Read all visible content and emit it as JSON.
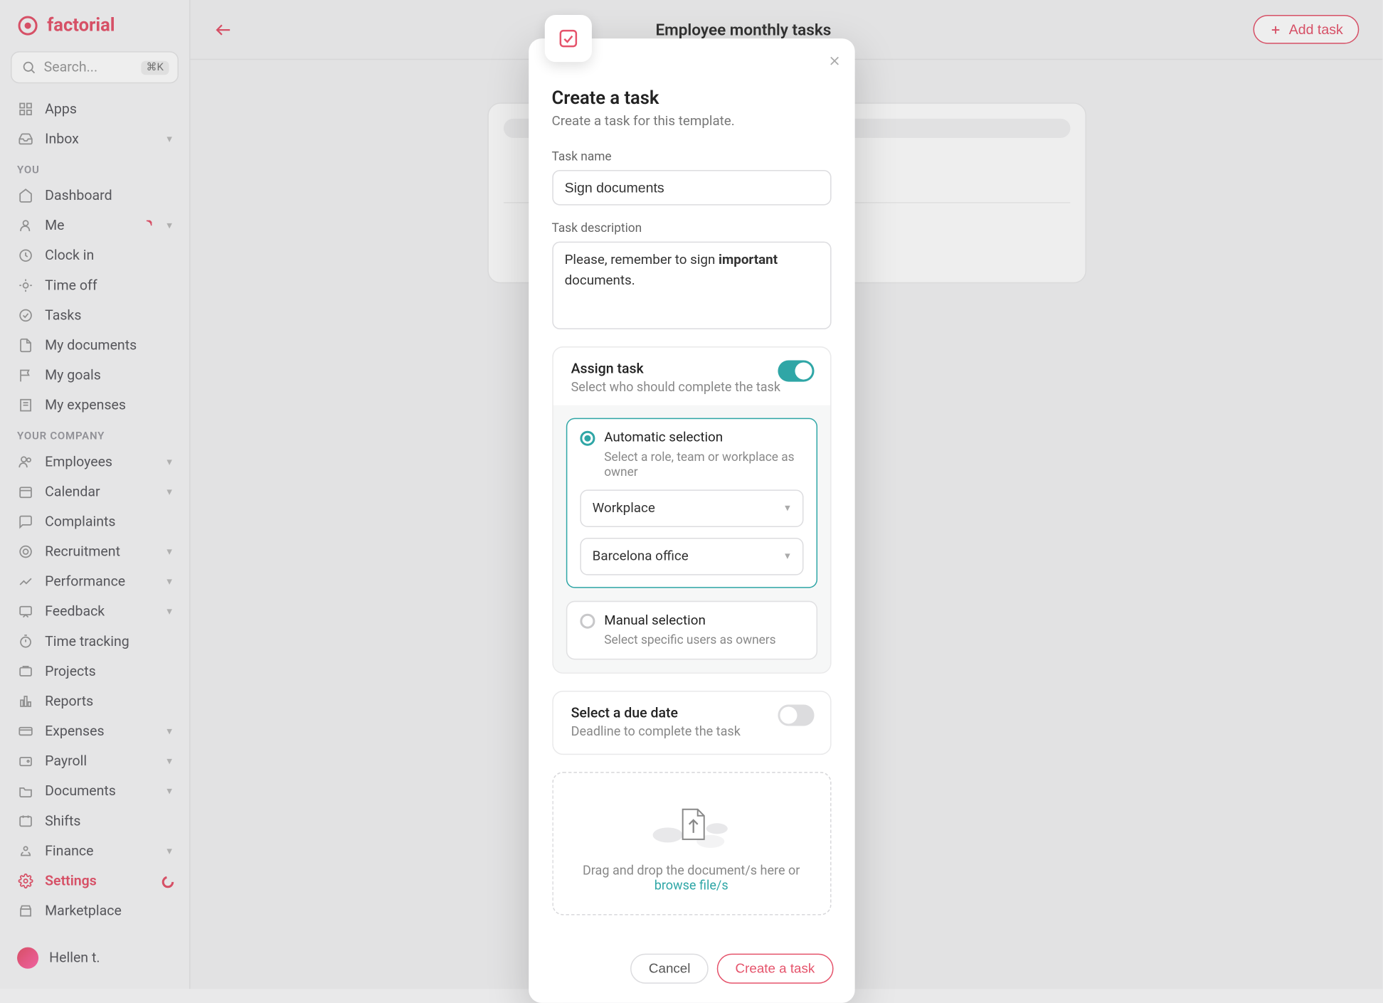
{
  "brand": {
    "name": "factorial"
  },
  "search": {
    "placeholder": "Search...",
    "shortcut": "⌘K"
  },
  "nav": {
    "apps": "Apps",
    "inbox": "Inbox",
    "section_you": "YOU",
    "dashboard": "Dashboard",
    "me": "Me",
    "clockin": "Clock in",
    "timeoff": "Time off",
    "tasks": "Tasks",
    "mydocs": "My documents",
    "mygoals": "My goals",
    "myexpenses": "My expenses",
    "section_company": "YOUR COMPANY",
    "employees": "Employees",
    "calendar": "Calendar",
    "complaints": "Complaints",
    "recruitment": "Recruitment",
    "performance": "Performance",
    "feedback": "Feedback",
    "timetracking": "Time tracking",
    "projects": "Projects",
    "reports": "Reports",
    "expenses": "Expenses",
    "payroll": "Payroll",
    "documents": "Documents",
    "shifts": "Shifts",
    "finance": "Finance",
    "settings": "Settings",
    "marketplace": "Marketplace"
  },
  "user": {
    "name": "Hellen t."
  },
  "header": {
    "title": "Employee monthly tasks",
    "add_task": "Add task"
  },
  "modal": {
    "title": "Create a task",
    "subtitle": "Create a task for this template.",
    "task_name_label": "Task name",
    "task_name_value": "Sign documents",
    "task_desc_label": "Task description",
    "task_desc_prefix": "Please, remember to sign ",
    "task_desc_bold": "important",
    "task_desc_suffix": " documents.",
    "assign_title": "Assign task",
    "assign_sub": "Select who should complete the task",
    "assign_enabled": true,
    "auto_title": "Automatic selection",
    "auto_sub": "Select a role, team or workplace as owner",
    "select_type": "Workplace",
    "select_value": "Barcelona office",
    "manual_title": "Manual selection",
    "manual_sub": "Select specific users as owners",
    "duedate_title": "Select a due date",
    "duedate_sub": "Deadline to complete the task",
    "duedate_enabled": false,
    "dropzone_text": "Drag and drop the document/s here or",
    "dropzone_link": "browse file/s",
    "cancel": "Cancel",
    "submit": "Create a task"
  }
}
